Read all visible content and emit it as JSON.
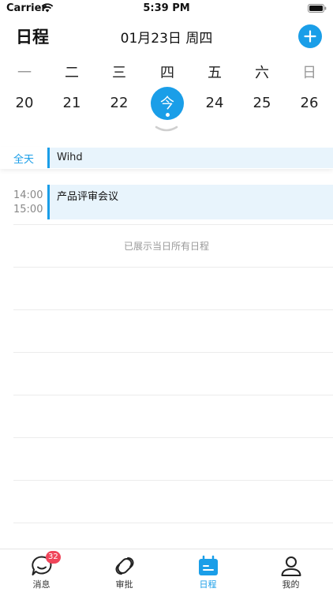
{
  "status_bar": {
    "carrier": "Carrier",
    "time": "5:39 PM"
  },
  "header": {
    "title": "日程",
    "date": "01月23日 周四"
  },
  "week": {
    "days": [
      {
        "weekday": "一",
        "date": "20"
      },
      {
        "weekday": "二",
        "date": "21"
      },
      {
        "weekday": "三",
        "date": "22"
      },
      {
        "weekday": "四",
        "date": "今"
      },
      {
        "weekday": "五",
        "date": "24"
      },
      {
        "weekday": "六",
        "date": "25"
      },
      {
        "weekday": "日",
        "date": "26"
      }
    ]
  },
  "all_day": {
    "label": "全天",
    "event_title": "Wihd"
  },
  "events": [
    {
      "start": "14:00",
      "end": "15:00",
      "title": "产品评审会议"
    }
  ],
  "all_shown_text": "已展示当日所有日程",
  "tabbar": {
    "messages": {
      "label": "消息",
      "badge": "32"
    },
    "approval": {
      "label": "审批"
    },
    "schedule": {
      "label": "日程"
    },
    "mine": {
      "label": "我的"
    }
  },
  "colors": {
    "accent": "#1a9ee8",
    "badge": "#f0455a",
    "event_bg": "#e8f4fc"
  }
}
